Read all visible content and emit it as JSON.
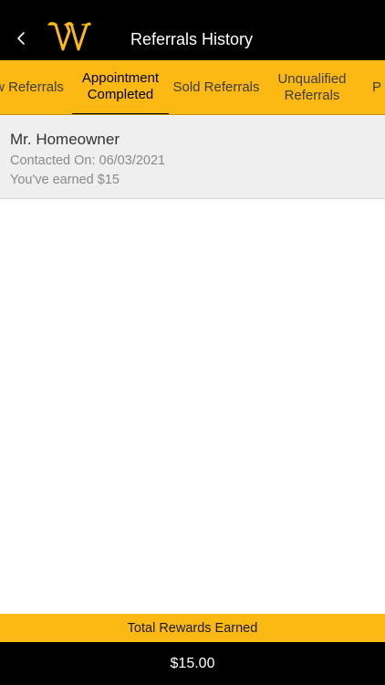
{
  "header": {
    "title": "Referrals History",
    "back_icon": "chevron-left-icon",
    "logo_icon": "w-logo-icon"
  },
  "tabs": [
    {
      "label": "New Referrals",
      "visible_text": "w Referrals",
      "active": false
    },
    {
      "label": "Appointment Completed",
      "line1": "Appointment",
      "line2": "Completed",
      "active": true
    },
    {
      "label": "Sold Referrals",
      "active": false
    },
    {
      "label": "Unqualified Referrals",
      "line1": "Unqualified",
      "line2": "Referrals",
      "active": false
    },
    {
      "label": "P",
      "active": false
    }
  ],
  "referrals": [
    {
      "name": "Mr. Homeowner",
      "contacted": "Contacted On: 06/03/2021",
      "earned": "You've earned $15"
    }
  ],
  "footer": {
    "rewards_label": "Total Rewards Earned",
    "total_value": "$15.00"
  },
  "colors": {
    "accent": "#fdb913",
    "header_bg": "#000000",
    "list_item_bg": "#efefef"
  }
}
